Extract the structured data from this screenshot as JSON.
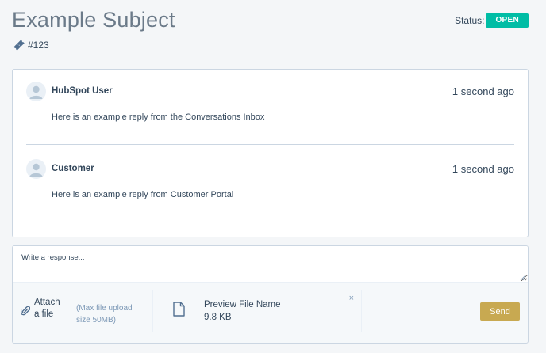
{
  "ticket": {
    "subject": "Example Subject",
    "id": "#123",
    "status_label": "Status:",
    "status_value": "OPEN"
  },
  "thread": {
    "messages": [
      {
        "author": "HubSpot User",
        "time": "1 second ago",
        "body": "Here is an example reply from the Conversations Inbox"
      },
      {
        "author": "Customer",
        "time": "1 second ago",
        "body": "Here is an example reply from Customer Portal"
      }
    ]
  },
  "reply": {
    "placeholder": "Write a response...",
    "attach_label": "Attach a file",
    "attach_hint": "(Max file upload size 50MB)",
    "attachment": {
      "name": "Preview File Name",
      "size": "9.8 KB",
      "remove_label": "×"
    },
    "send_label": "Send"
  },
  "colors": {
    "status_open": "#00bda5",
    "send_button": "#c8a951",
    "text": "#33475b",
    "border": "#cbd6e2",
    "background": "#f4f6f8"
  }
}
